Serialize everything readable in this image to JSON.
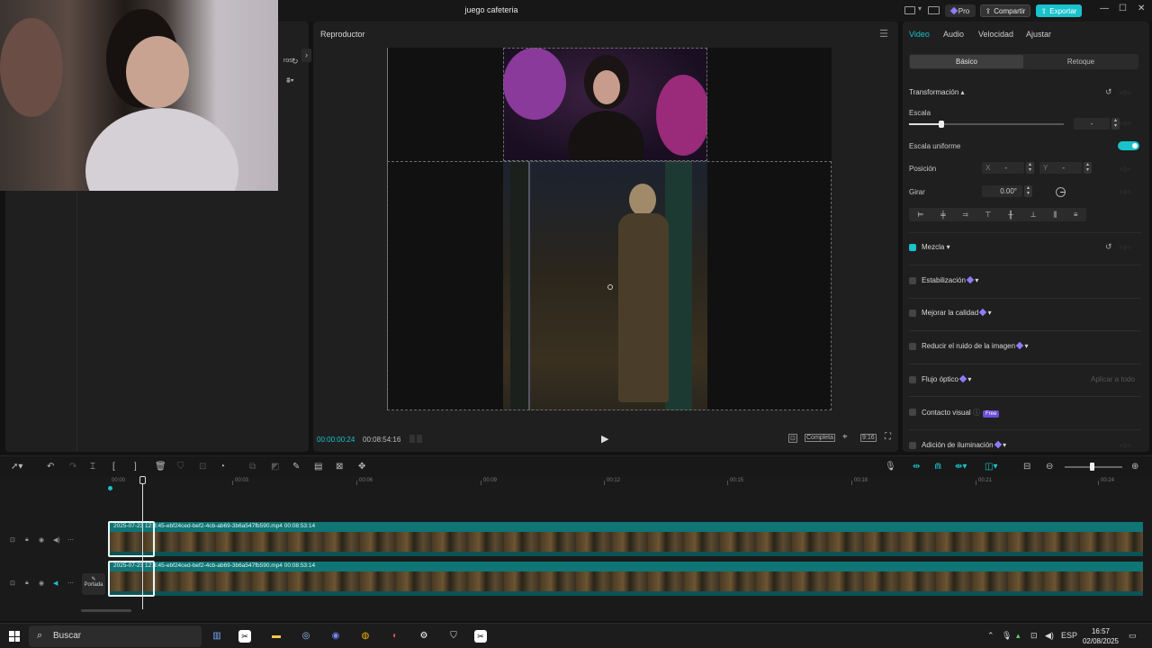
{
  "app": {
    "title": "juego cafeteria"
  },
  "header": {
    "pro": "Pro",
    "share": "Compartir",
    "export": "Exportar",
    "minimize": "—",
    "maximize": "☐",
    "close": "✕"
  },
  "left_panel": {
    "effects_label": "ros"
  },
  "player": {
    "title": "Reproductor",
    "current_time": "00:00:00:24",
    "duration": "00:08:54:16",
    "full_label": "Completa",
    "ratio": "9:16"
  },
  "props": {
    "tabs": [
      "Video",
      "Audio",
      "Velocidad",
      "Ajustar"
    ],
    "active_tab": "Video",
    "segments": [
      "Básico",
      "Retoque"
    ],
    "transform_title": "Transformación",
    "scale_label": "Escala",
    "scale_value": "-",
    "uniform_scale_label": "Escala uniforme",
    "position_label": "Posición",
    "pos_x_label": "X",
    "pos_x_value": "-",
    "pos_y_label": "Y",
    "pos_y_value": "-",
    "rotate_label": "Girar",
    "rotate_value": "0.00°",
    "blend_label": "Mezcla",
    "stabilize_label": "Estabilización",
    "quality_label": "Mejorar la calidad",
    "noise_label": "Reducir el ruido de la imagen",
    "flow_label": "Flujo óptico",
    "apply_all": "Aplicar a todo",
    "contact_label": "Contacto visual",
    "free_badge": "Free",
    "lighting_label": "Adición de iluminación"
  },
  "timeline": {
    "ruler": [
      "00:00",
      "00:03",
      "00:06",
      "00:09",
      "00:12",
      "00:15",
      "00:18",
      "00:21",
      "00:24"
    ],
    "tracks": [
      {
        "name": "2025-07-23 12:3:45-ebf24ced-bef2-4cb-ab69-3b6a547fb590.mp4",
        "duration": "00:08:53:14"
      },
      {
        "name": "2025-07-23 12:3:45-ebf24ced-bef2-4cb-ab69-3b6a547fb590.mp4",
        "duration": "00:08:53:14"
      }
    ],
    "cover_label": "Portada"
  },
  "taskbar": {
    "search_placeholder": "Buscar",
    "lang": "ESP",
    "time": "16:57",
    "date": "02/08/2025"
  },
  "colors": {
    "accent": "#19c2cc",
    "track": "#0e6a6a",
    "panel": "#1f1f1f",
    "background": "#121212"
  }
}
